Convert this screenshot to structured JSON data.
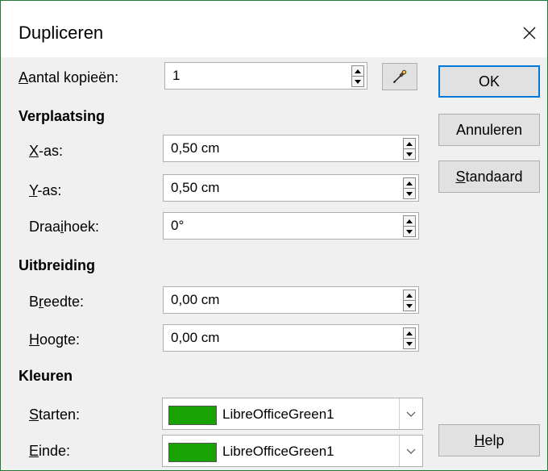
{
  "window": {
    "title": "Dupliceren"
  },
  "copies": {
    "label_accel": "A",
    "label_rest": "antal kopieën:",
    "value": "1"
  },
  "placement": {
    "heading": "Verplaatsing",
    "x": {
      "label_accel": "X",
      "label_rest": "-as:",
      "value": "0,50 cm"
    },
    "y": {
      "label_accel": "Y",
      "label_rest": "-as:",
      "value": "0,50 cm"
    },
    "angle": {
      "label_pre": "Draa",
      "label_accel": "i",
      "label_post": "hoek:",
      "value": "0°"
    }
  },
  "enlargement": {
    "heading": "Uitbreiding",
    "width": {
      "label_pre": "B",
      "label_accel": "r",
      "label_post": "eedte:",
      "value": "0,00 cm"
    },
    "height": {
      "label_accel": "H",
      "label_rest": "oogte:",
      "value": "0,00 cm"
    }
  },
  "colors": {
    "heading": "Kleuren",
    "start": {
      "label_accel": "S",
      "label_rest": "tarten:",
      "value": "LibreOfficeGreen1",
      "swatch": "#18a303"
    },
    "end": {
      "label_accel": "E",
      "label_rest": "inde:",
      "value": "LibreOfficeGreen1",
      "swatch": "#18a303"
    }
  },
  "buttons": {
    "ok": "OK",
    "cancel": "Annuleren",
    "default_accel": "S",
    "default_rest": "tandaard",
    "help_accel": "H",
    "help_rest": "elp"
  },
  "icons": {
    "close": "close-icon",
    "pipette": "pipette-icon"
  },
  "colors_ui": {
    "accent": "#0078d7",
    "window_border": "#1e7a36"
  }
}
